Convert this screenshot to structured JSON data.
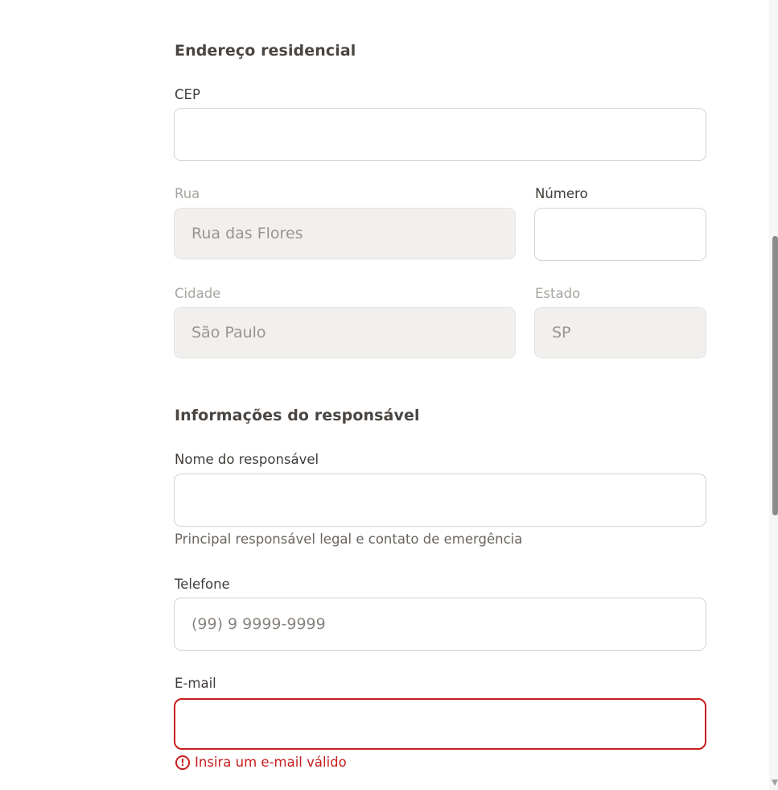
{
  "address": {
    "title": "Endereço residencial",
    "cep": {
      "label": "CEP",
      "value": ""
    },
    "rua": {
      "label": "Rua",
      "value": "Rua das Flores",
      "disabled": true
    },
    "numero": {
      "label": "Número",
      "value": ""
    },
    "cidade": {
      "label": "Cidade",
      "value": "São Paulo",
      "disabled": true
    },
    "estado": {
      "label": "Estado",
      "value": "SP",
      "disabled": true
    }
  },
  "guardian": {
    "title": "Informações do responsável",
    "nome": {
      "label": "Nome do responsável",
      "value": "",
      "helper": "Principal responsável legal e contato de emergência"
    },
    "telefone": {
      "label": "Telefone",
      "placeholder": "(99) 9 9999-9999",
      "value": ""
    },
    "email": {
      "label": "E-mail",
      "value": "",
      "error": "Insira um e-mail válido",
      "error_icon": "alert-circle-icon"
    }
  },
  "colors": {
    "error": "#c81e1e",
    "disabled_bg": "#f1f0ee",
    "border": "#d7d3cf"
  }
}
